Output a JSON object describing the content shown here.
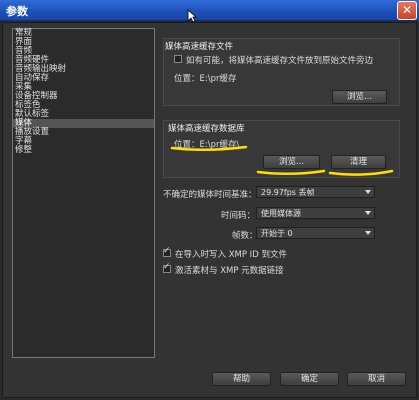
{
  "window": {
    "title": "参数",
    "close_symbol": "✕"
  },
  "sidebar": {
    "items": [
      {
        "label": "常规"
      },
      {
        "label": "界面"
      },
      {
        "label": "音频"
      },
      {
        "label": "音频硬件"
      },
      {
        "label": "音频输出映射"
      },
      {
        "label": "自动保存"
      },
      {
        "label": "采集"
      },
      {
        "label": "设备控制器"
      },
      {
        "label": "标签色"
      },
      {
        "label": "默认标签"
      },
      {
        "label": "媒体"
      },
      {
        "label": "播放设置"
      },
      {
        "label": "字幕"
      },
      {
        "label": "修整"
      }
    ],
    "selected_index": 10
  },
  "media_cache_files": {
    "title": "媒体高速缓存文件",
    "option_label": "如有可能，将媒体高速缓存文件放到原始文件旁边",
    "option_checked": false,
    "location_text": "位置：E:\\pr缓存",
    "browse_label": "浏览..."
  },
  "media_cache_db": {
    "title": "媒体高速缓存数据库",
    "location_text": "位置：E:\\pr缓存\\",
    "browse_label": "浏览...",
    "clean_label": "清理"
  },
  "settings": {
    "timebase_label": "不确定的媒体时间基准：",
    "timebase_value": "29.97fps 丢帧",
    "timecode_label": "时间码：",
    "timecode_value": "使用媒体源",
    "frame_label": "帧数：",
    "frame_value": "开始于 0",
    "xmp_write_label": "在导入时写入 XMP ID 到文件",
    "xmp_write_checked": true,
    "xmp_link_label": "激活素材与 XMP 元数据链接",
    "xmp_link_checked": true
  },
  "footer": {
    "help_label": "帮助",
    "ok_label": "确定",
    "cancel_label": "取消"
  },
  "colors": {
    "annotation": "#ffe000",
    "titlebar": "#2f6cd8"
  }
}
